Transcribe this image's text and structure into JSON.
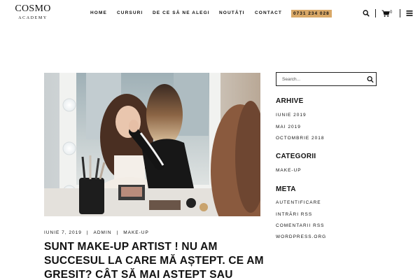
{
  "brand": {
    "name": "COSMO",
    "sub": "ACADEMY"
  },
  "nav": {
    "items": [
      "Home",
      "Cursuri",
      "De ce să ne alegi",
      "Noutăți",
      "Contact"
    ],
    "phone": "0731 234 028"
  },
  "cart": {
    "count": "0"
  },
  "post": {
    "date": "Iunie 7, 2019",
    "author": "Admin",
    "category": "Make-up",
    "separator": "|",
    "title": "Sunt make-up artist ! Nu am succesul la care mă aștept. Ce am gresit? Cât să mai astept sau"
  },
  "sidebar": {
    "search": {
      "placeholder": "Search..."
    },
    "archives": {
      "title": "Arhive",
      "items": [
        "Iunie 2019",
        "Mai 2019",
        "Octombrie 2018"
      ]
    },
    "categories": {
      "title": "Categorii",
      "items": [
        "Make-up"
      ]
    },
    "meta": {
      "title": "Meta",
      "items": [
        "Autentificare",
        "Intrări RSS",
        "Comentarii RSS",
        "WordPress.org"
      ]
    }
  },
  "icons": {
    "search": "search-icon",
    "cart": "cart-icon",
    "menu": "menu-icon"
  },
  "colors": {
    "accent": "#d9a867",
    "text": "#111111",
    "background": "#ffffff"
  }
}
